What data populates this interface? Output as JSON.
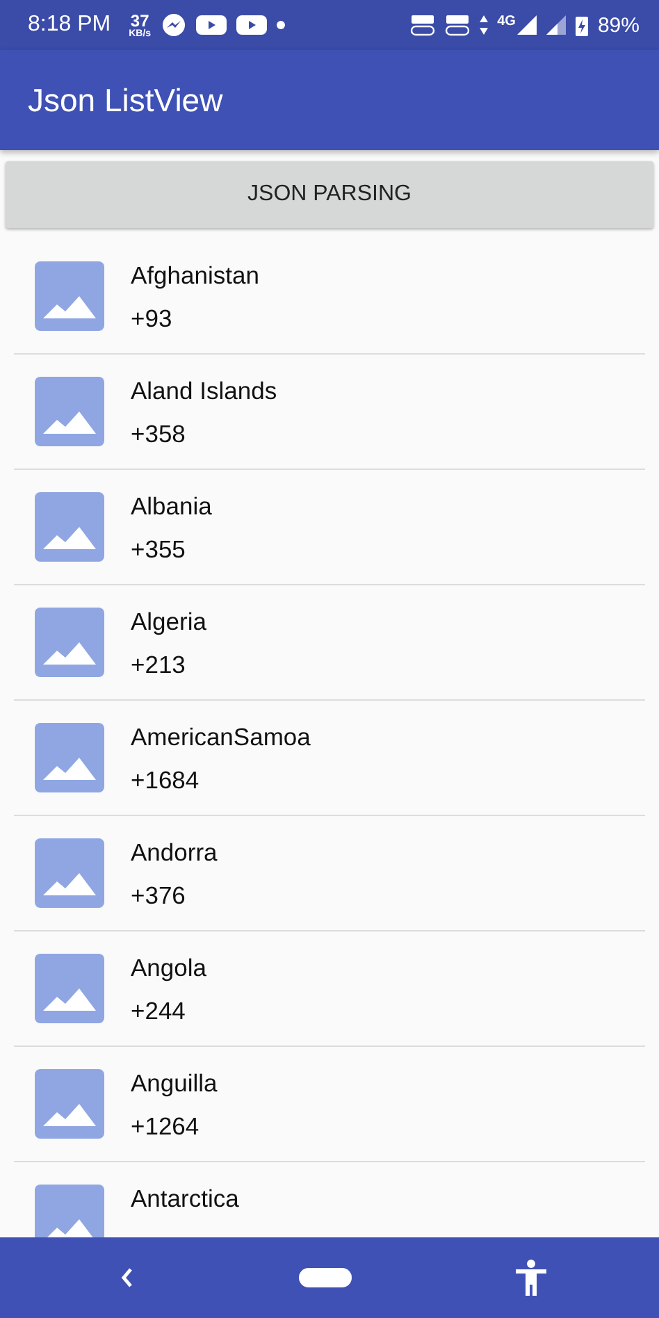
{
  "status_bar": {
    "time": "8:18 PM",
    "speed": "37",
    "speed_unit": "KB/s",
    "network": "4G",
    "battery": "89%"
  },
  "app_bar": {
    "title": "Json ListView"
  },
  "button": {
    "label": "JSON PARSING"
  },
  "items": [
    {
      "name": "Afghanistan",
      "code": "+93"
    },
    {
      "name": "Aland Islands",
      "code": "+358"
    },
    {
      "name": "Albania",
      "code": "+355"
    },
    {
      "name": "Algeria",
      "code": "+213"
    },
    {
      "name": "AmericanSamoa",
      "code": "+1684"
    },
    {
      "name": "Andorra",
      "code": "+376"
    },
    {
      "name": "Angola",
      "code": "+244"
    },
    {
      "name": "Anguilla",
      "code": "+1264"
    },
    {
      "name": "Antarctica"
    }
  ]
}
